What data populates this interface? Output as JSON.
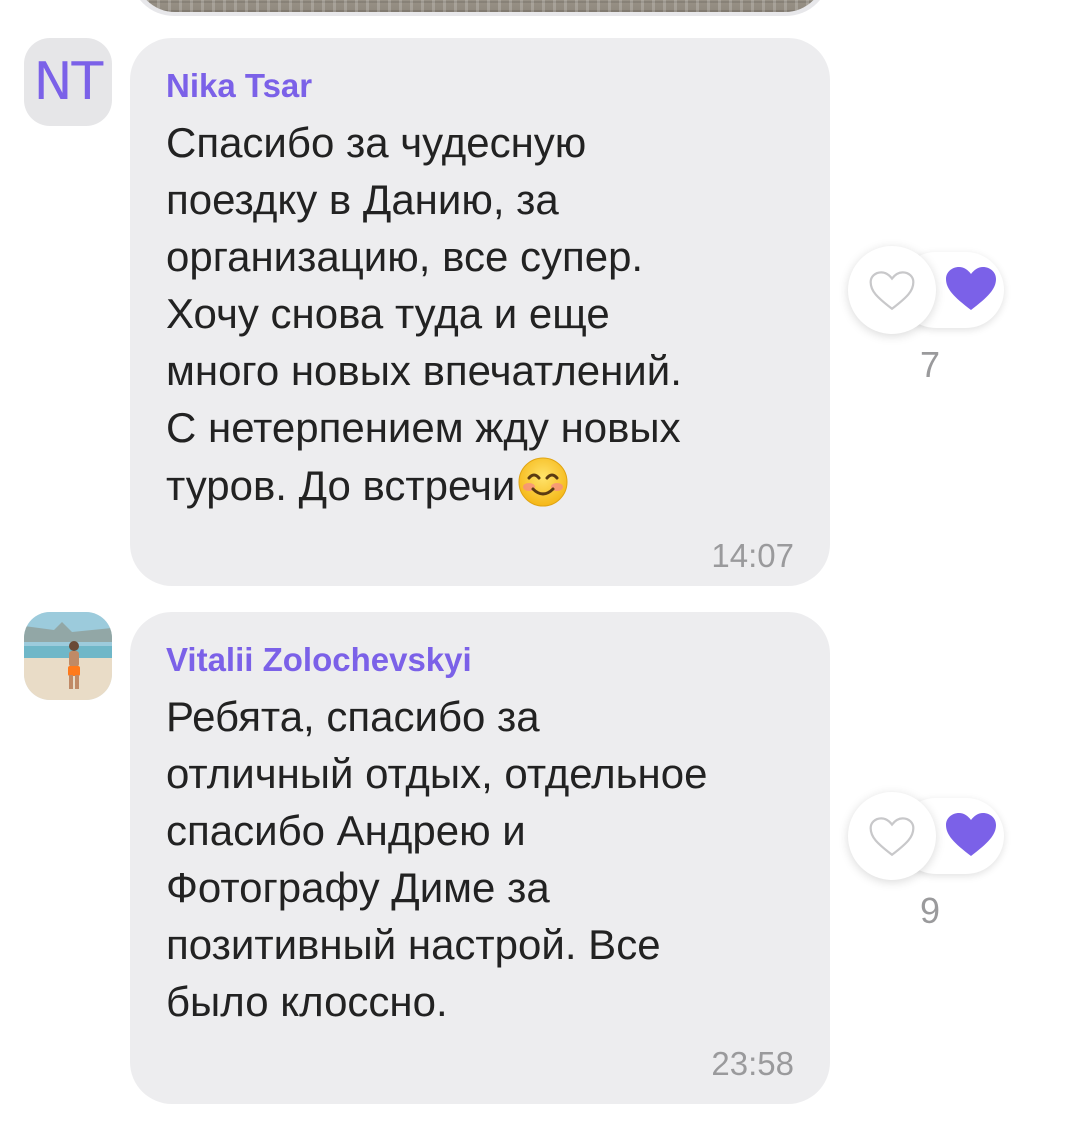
{
  "messages": [
    {
      "avatar_initials": "NT",
      "sender": "Nika Tsar",
      "text": "Спасибо за чудесную\nпоездку в Данию, за\nорганизацию, все супер.\nХочу снова туда и еще\nмного новых впечатлений.\nС нетерпением жду новых\nтуров. До встречи",
      "emoji": "smiling-face-emoji",
      "time": "14:07",
      "likes": "7"
    },
    {
      "avatar_initials": "",
      "sender": "Vitalii Zolochevskyi",
      "text": "Ребята, спасибо за\nотличный отдых, отдельное\nспасибо Андрею и\nФотографу Диме за\nпозитивный настрой. Все\nбыло клоссно.",
      "time": "23:58",
      "likes": "9"
    }
  ],
  "colors": {
    "accent": "#7b61e8",
    "bubble": "#ededef",
    "muted": "#9a9a9c"
  }
}
